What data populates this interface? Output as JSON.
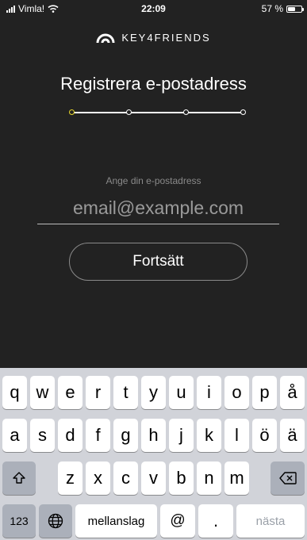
{
  "status_bar": {
    "carrier": "Vimla!",
    "time": "22:09",
    "battery": "57 %",
    "battery_level": 0.57
  },
  "brand": {
    "logo_text": "KEY4FRIENDS"
  },
  "page": {
    "title": "Registrera e-postadress"
  },
  "stepper": {
    "current_step": 1,
    "total_steps": 4
  },
  "form": {
    "email_label": "Ange din e-postadress",
    "email_placeholder": "email@example.com",
    "email_value": "",
    "continue_label": "Fortsätt"
  },
  "keyboard": {
    "row1": [
      "q",
      "w",
      "e",
      "r",
      "t",
      "y",
      "u",
      "i",
      "o",
      "p",
      "å"
    ],
    "row2": [
      "a",
      "s",
      "d",
      "f",
      "g",
      "h",
      "j",
      "k",
      "l",
      "ö",
      "ä"
    ],
    "row3": [
      "z",
      "x",
      "c",
      "v",
      "b",
      "n",
      "m"
    ],
    "row4": {
      "numbers": "123",
      "space": "mellanslag",
      "at": "@",
      "dot": ".",
      "next": "nästa"
    },
    "icons": {
      "shift": "shift-icon",
      "delete": "backspace-icon",
      "globe": "globe-icon"
    }
  }
}
